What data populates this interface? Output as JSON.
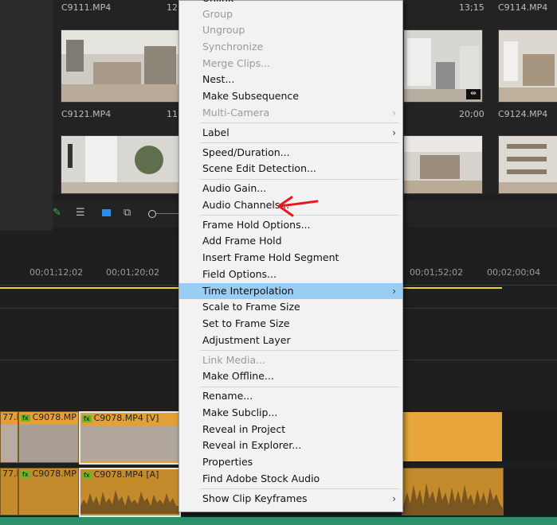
{
  "project": {
    "clips_row1": [
      {
        "name": "C9111.MP4",
        "time": "12;"
      },
      {
        "name": "",
        "time": "13;15"
      },
      {
        "name": "C9114.MP4",
        "time": ""
      }
    ],
    "clips_row2": [
      {
        "name": "C9121.MP4",
        "time": "11;"
      },
      {
        "name": "",
        "time": "20;00"
      },
      {
        "name": "C9124.MP4",
        "time": ""
      }
    ]
  },
  "timeline": {
    "ruler": [
      "00;01;12;02",
      "00;01;20;02",
      "00;01;52;02",
      "00;02;00;04"
    ],
    "video_clips": [
      {
        "label": "77.M",
        "fx": false
      },
      {
        "label": "C9078.MP",
        "fx": true
      },
      {
        "label": "C9078.MP4 [V]",
        "fx": true
      }
    ],
    "audio_clips": [
      {
        "label": "77.M",
        "fx": false
      },
      {
        "label": "C9078.MP",
        "fx": true
      },
      {
        "label": "C9078.MP4 [A]",
        "fx": true
      }
    ]
  },
  "menu": {
    "top_partial": "Unlink",
    "groups": [
      [
        {
          "label": "Group",
          "disabled": true
        },
        {
          "label": "Ungroup",
          "disabled": true
        },
        {
          "label": "Synchronize",
          "disabled": true
        },
        {
          "label": "Merge Clips...",
          "disabled": true
        },
        {
          "label": "Nest...",
          "disabled": false
        },
        {
          "label": "Make Subsequence",
          "disabled": false
        },
        {
          "label": "Multi-Camera",
          "disabled": true,
          "submenu": true
        }
      ],
      [
        {
          "label": "Label",
          "disabled": false,
          "submenu": true
        }
      ],
      [
        {
          "label": "Speed/Duration...",
          "disabled": false
        },
        {
          "label": "Scene Edit Detection...",
          "disabled": false
        }
      ],
      [
        {
          "label": "Audio Gain...",
          "disabled": false
        },
        {
          "label": "Audio Channels...",
          "disabled": false
        }
      ],
      [
        {
          "label": "Frame Hold Options...",
          "disabled": false
        },
        {
          "label": "Add Frame Hold",
          "disabled": false
        },
        {
          "label": "Insert Frame Hold Segment",
          "disabled": false
        },
        {
          "label": "Field Options...",
          "disabled": false
        },
        {
          "label": "Time Interpolation",
          "disabled": false,
          "submenu": true,
          "highlight": true
        },
        {
          "label": "Scale to Frame Size",
          "disabled": false
        },
        {
          "label": "Set to Frame Size",
          "disabled": false
        },
        {
          "label": "Adjustment Layer",
          "disabled": false
        }
      ],
      [
        {
          "label": "Link Media...",
          "disabled": true
        },
        {
          "label": "Make Offline...",
          "disabled": false
        }
      ],
      [
        {
          "label": "Rename...",
          "disabled": false
        },
        {
          "label": "Make Subclip...",
          "disabled": false
        },
        {
          "label": "Reveal in Project",
          "disabled": false
        },
        {
          "label": "Reveal in Explorer...",
          "disabled": false
        },
        {
          "label": "Properties",
          "disabled": false
        },
        {
          "label": "Find Adobe Stock Audio",
          "disabled": false
        }
      ],
      [
        {
          "label": "Show Clip Keyframes",
          "disabled": false,
          "submenu": true
        }
      ]
    ]
  },
  "colors": {
    "menu_bg": "#f2f2f2",
    "highlight": "#99cdf4",
    "clip_orange": "#e3a035",
    "playhead": "#e8d33a",
    "annotation": "#e8181f"
  }
}
